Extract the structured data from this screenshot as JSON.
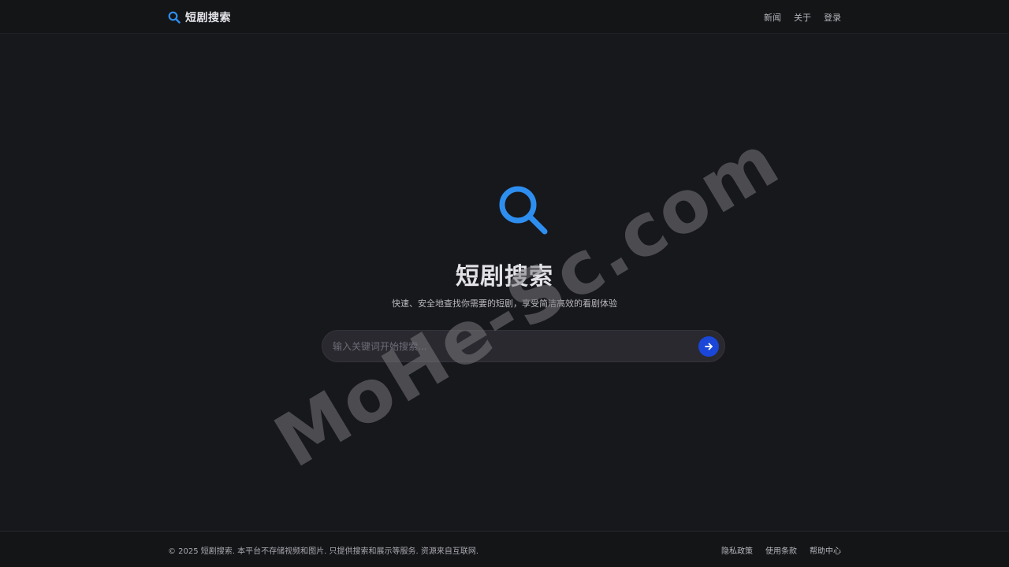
{
  "header": {
    "brand": "短剧搜索",
    "nav": [
      "新闻",
      "关于",
      "登录"
    ]
  },
  "hero": {
    "title": "短剧搜索",
    "subtitle": "快速、安全地查找你需要的短剧，享受简洁高效的看剧体验"
  },
  "search": {
    "placeholder": "输入关键词开始搜索..."
  },
  "watermark": "MoHe-Sc.com",
  "footer": {
    "copyright": "© 2025 短剧搜索. 本平台不存储视频和图片. 只提供搜索和展示等服务. 资源来自互联网.",
    "links": [
      "隐私政策",
      "使用条款",
      "帮助中心"
    ]
  },
  "colors": {
    "accent": "#2e8ef0",
    "button": "#1a47d8",
    "background": "#17181b"
  },
  "icons": {
    "brand": "search-icon",
    "hero": "search-icon",
    "submit": "arrow-right-icon"
  }
}
